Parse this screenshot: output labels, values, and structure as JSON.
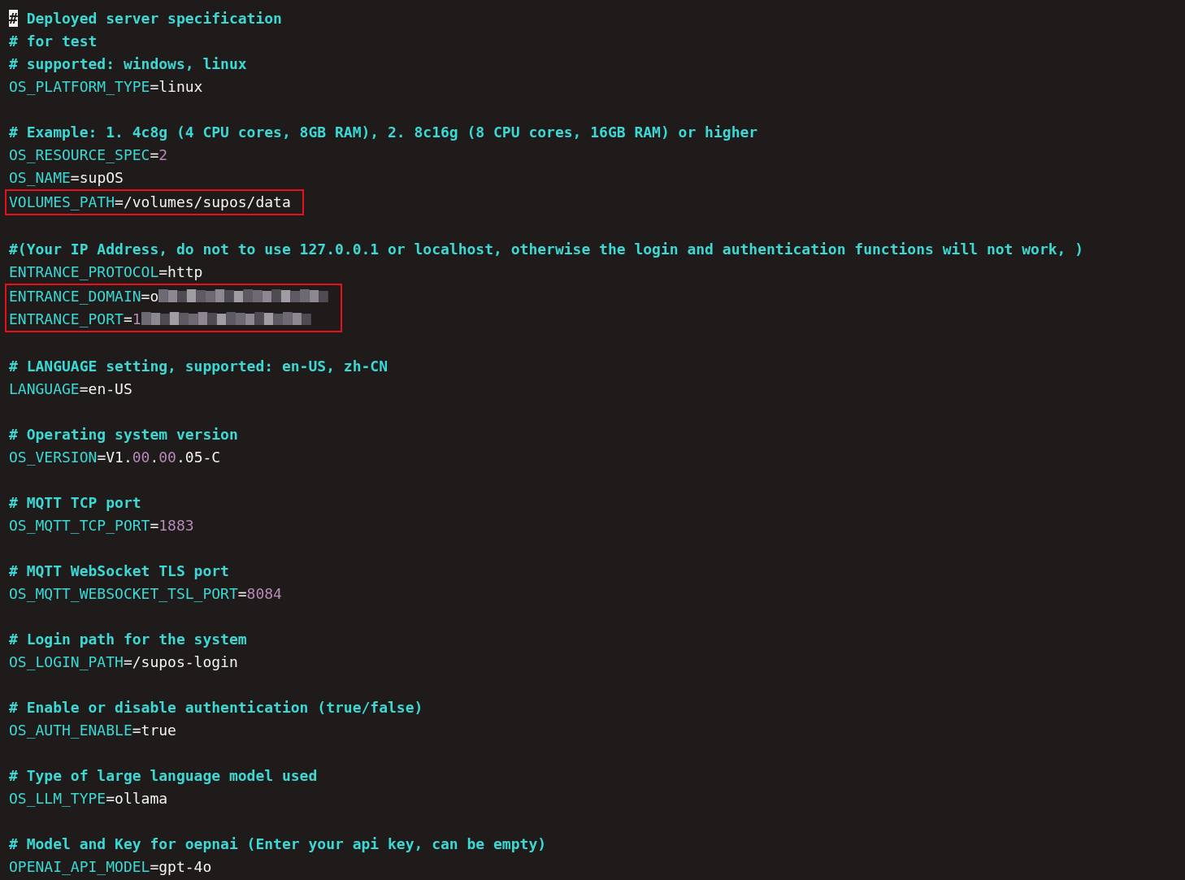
{
  "lines": [
    {
      "kind": "comment",
      "text": "# Deployed server specification",
      "cursor": true
    },
    {
      "kind": "comment",
      "text": "# for test",
      "cursor": false
    },
    {
      "kind": "comment",
      "text": "# supported: windows, linux",
      "cursor": false
    },
    {
      "kind": "setting",
      "key": "OS_PLATFORM_TYPE",
      "separator": "=",
      "value": [
        {
          "kind": "text",
          "text": "linux"
        }
      ],
      "boxed": false
    },
    {
      "kind": "blank"
    },
    {
      "kind": "comment",
      "text": "# Example: 1. 4c8g (4 CPU cores, 8GB RAM), 2. 8c16g (8 CPU cores, 16GB RAM) or higher",
      "cursor": false
    },
    {
      "kind": "setting",
      "key": "OS_RESOURCE_SPEC",
      "separator": "=",
      "value": [
        {
          "kind": "number",
          "text": "2"
        }
      ],
      "boxed": false
    },
    {
      "kind": "setting",
      "key": "OS_NAME",
      "separator": "=",
      "value": [
        {
          "kind": "text",
          "text": "supOS"
        }
      ],
      "boxed": false
    },
    {
      "kind": "setting",
      "key": "VOLUMES_PATH",
      "separator": "=",
      "value": [
        {
          "kind": "text",
          "text": "/volumes/supos/data"
        }
      ],
      "boxed": true
    },
    {
      "kind": "blank"
    },
    {
      "kind": "comment",
      "text": "#(Your IP Address, do not to use 127.0.0.1 or localhost, otherwise the login and authentication functions will not work, )",
      "cursor": false
    },
    {
      "kind": "setting",
      "key": "ENTRANCE_PROTOCOL",
      "separator": "=",
      "value": [
        {
          "kind": "text",
          "text": "http"
        }
      ],
      "boxed": false
    },
    {
      "kind": "setting",
      "key": "ENTRANCE_DOMAIN",
      "separator": "=",
      "value": [
        {
          "kind": "text",
          "text": "o"
        },
        {
          "kind": "redacted"
        }
      ],
      "boxed": true
    },
    {
      "kind": "setting",
      "key": "ENTRANCE_PORT",
      "separator": "=",
      "value": [
        {
          "kind": "number",
          "text": "1"
        },
        {
          "kind": "redacted"
        }
      ],
      "boxed": true
    },
    {
      "kind": "blank"
    },
    {
      "kind": "comment",
      "text": "# LANGUAGE setting, supported: en-US, zh-CN",
      "cursor": false
    },
    {
      "kind": "setting",
      "key": "LANGUAGE",
      "separator": "=",
      "value": [
        {
          "kind": "text",
          "text": "en-US"
        }
      ],
      "boxed": false
    },
    {
      "kind": "blank"
    },
    {
      "kind": "comment",
      "text": "# Operating system version",
      "cursor": false
    },
    {
      "kind": "setting",
      "key": "OS_VERSION",
      "separator": "=",
      "value": [
        {
          "kind": "text",
          "text": "V1."
        },
        {
          "kind": "number",
          "text": "00"
        },
        {
          "kind": "text",
          "text": "."
        },
        {
          "kind": "number",
          "text": "00"
        },
        {
          "kind": "text",
          "text": ".05-C"
        }
      ],
      "boxed": false
    },
    {
      "kind": "blank"
    },
    {
      "kind": "comment",
      "text": "# MQTT TCP port",
      "cursor": false
    },
    {
      "kind": "setting",
      "key": "OS_MQTT_TCP_PORT",
      "separator": "=",
      "value": [
        {
          "kind": "number",
          "text": "1883"
        }
      ],
      "boxed": false
    },
    {
      "kind": "blank"
    },
    {
      "kind": "comment",
      "text": "# MQTT WebSocket TLS port",
      "cursor": false
    },
    {
      "kind": "setting",
      "key": "OS_MQTT_WEBSOCKET_TSL_PORT",
      "separator": "=",
      "value": [
        {
          "kind": "number",
          "text": "8084"
        }
      ],
      "boxed": false
    },
    {
      "kind": "blank"
    },
    {
      "kind": "comment",
      "text": "# Login path for the system",
      "cursor": false
    },
    {
      "kind": "setting",
      "key": "OS_LOGIN_PATH",
      "separator": "=",
      "value": [
        {
          "kind": "text",
          "text": "/supos-login"
        }
      ],
      "boxed": false
    },
    {
      "kind": "blank"
    },
    {
      "kind": "comment",
      "text": "# Enable or disable authentication (true/false)",
      "cursor": false
    },
    {
      "kind": "setting",
      "key": "OS_AUTH_ENABLE",
      "separator": "=",
      "value": [
        {
          "kind": "text",
          "text": "true"
        }
      ],
      "boxed": false
    },
    {
      "kind": "blank"
    },
    {
      "kind": "comment",
      "text": "# Type of large language model used",
      "cursor": false
    },
    {
      "kind": "setting",
      "key": "OS_LLM_TYPE",
      "separator": "=",
      "value": [
        {
          "kind": "text",
          "text": "ollama"
        }
      ],
      "boxed": false
    },
    {
      "kind": "blank"
    },
    {
      "kind": "comment",
      "text": "# Model and Key for oepnai (Enter your api key, can be empty)",
      "cursor": false
    },
    {
      "kind": "setting",
      "key": "OPENAI_API_MODEL",
      "separator": "=",
      "value": [
        {
          "kind": "text",
          "text": "gpt-4o"
        }
      ],
      "boxed": false
    }
  ]
}
